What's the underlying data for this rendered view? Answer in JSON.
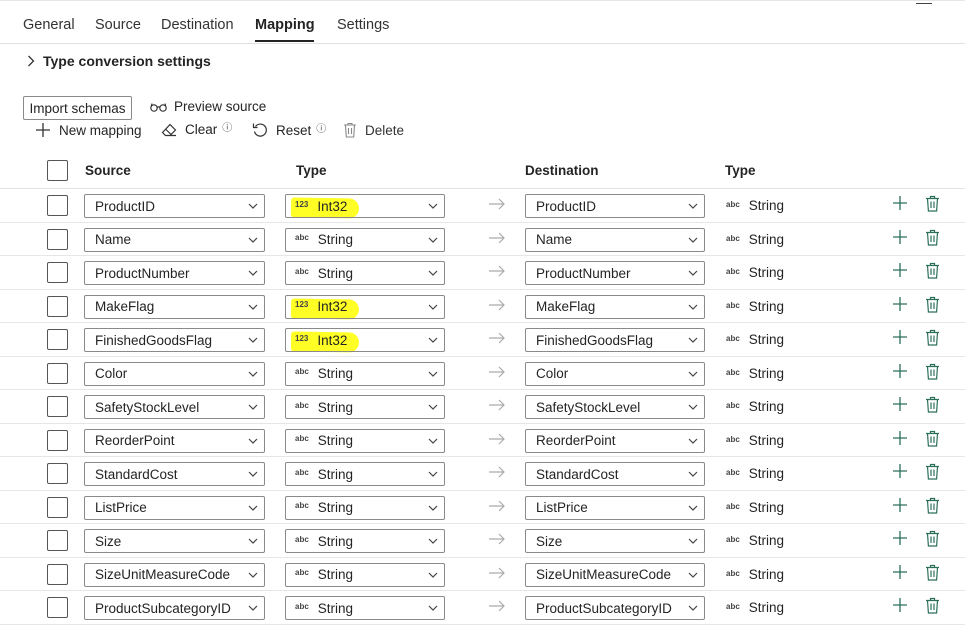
{
  "tabs": [
    "General",
    "Source",
    "Destination",
    "Mapping",
    "Settings"
  ],
  "active_tab": "Mapping",
  "expander_label": "Type conversion settings",
  "import_button": "Import schemas",
  "preview_button": "Preview source",
  "toolbar": {
    "new_mapping": "New mapping",
    "clear": "Clear",
    "reset": "Reset",
    "delete": "Delete",
    "info_glyph": "ⓘ"
  },
  "headers": {
    "source": "Source",
    "type": "Type",
    "destination": "Destination",
    "dest_type": "Type"
  },
  "type_tags": {
    "string": "abc",
    "int": "123"
  },
  "highlight_color": "#ffff00",
  "rows": [
    {
      "source": "ProductID",
      "type": "Int32",
      "type_tag": "123",
      "highlighted": true,
      "destination": "ProductID",
      "dest_type": "String"
    },
    {
      "source": "Name",
      "type": "String",
      "type_tag": "abc",
      "highlighted": false,
      "destination": "Name",
      "dest_type": "String"
    },
    {
      "source": "ProductNumber",
      "type": "String",
      "type_tag": "abc",
      "highlighted": false,
      "destination": "ProductNumber",
      "dest_type": "String"
    },
    {
      "source": "MakeFlag",
      "type": "Int32",
      "type_tag": "123",
      "highlighted": true,
      "destination": "MakeFlag",
      "dest_type": "String"
    },
    {
      "source": "FinishedGoodsFlag",
      "type": "Int32",
      "type_tag": "123",
      "highlighted": true,
      "destination": "FinishedGoodsFlag",
      "dest_type": "String"
    },
    {
      "source": "Color",
      "type": "String",
      "type_tag": "abc",
      "highlighted": false,
      "destination": "Color",
      "dest_type": "String"
    },
    {
      "source": "SafetyStockLevel",
      "type": "String",
      "type_tag": "abc",
      "highlighted": false,
      "destination": "SafetyStockLevel",
      "dest_type": "String"
    },
    {
      "source": "ReorderPoint",
      "type": "String",
      "type_tag": "abc",
      "highlighted": false,
      "destination": "ReorderPoint",
      "dest_type": "String"
    },
    {
      "source": "StandardCost",
      "type": "String",
      "type_tag": "abc",
      "highlighted": false,
      "destination": "StandardCost",
      "dest_type": "String"
    },
    {
      "source": "ListPrice",
      "type": "String",
      "type_tag": "abc",
      "highlighted": false,
      "destination": "ListPrice",
      "dest_type": "String"
    },
    {
      "source": "Size",
      "type": "String",
      "type_tag": "abc",
      "highlighted": false,
      "destination": "Size",
      "dest_type": "String"
    },
    {
      "source": "SizeUnitMeasureCode",
      "type": "String",
      "type_tag": "abc",
      "highlighted": false,
      "destination": "SizeUnitMeasureCode",
      "dest_type": "String"
    },
    {
      "source": "ProductSubcategoryID",
      "type": "String",
      "type_tag": "abc",
      "highlighted": false,
      "destination": "ProductSubcategoryID",
      "dest_type": "String"
    }
  ]
}
